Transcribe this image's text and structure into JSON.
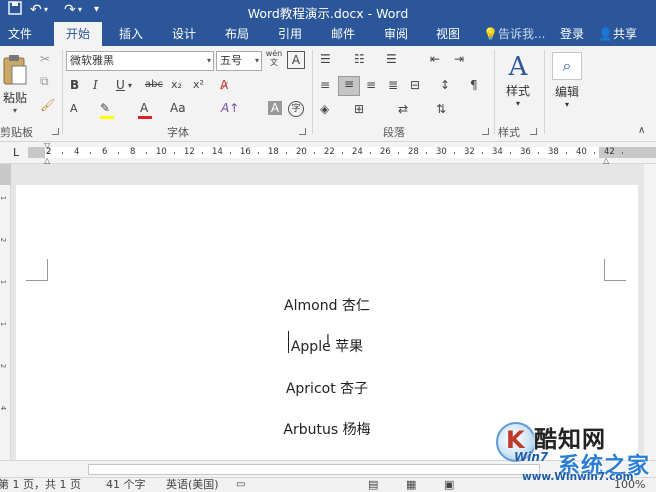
{
  "titlebar": {
    "title": "Word教程演示.docx - Word",
    "save_icon": "save-icon",
    "undo_icon": "undo-icon",
    "redo_icon": "redo-icon"
  },
  "menu": {
    "tabs": [
      {
        "label": "文件"
      },
      {
        "label": "开始",
        "active": true
      },
      {
        "label": "插入"
      },
      {
        "label": "设计"
      },
      {
        "label": "布局"
      },
      {
        "label": "引用"
      },
      {
        "label": "邮件"
      },
      {
        "label": "审阅"
      },
      {
        "label": "视图"
      }
    ],
    "tell_me": "告诉我...",
    "login": "登录",
    "share": "共享"
  },
  "ribbon": {
    "clipboard": {
      "paste": "粘贴",
      "label": "剪贴板"
    },
    "font": {
      "font_name": "微软雅黑",
      "font_size": "五号",
      "bold": "B",
      "italic": "I",
      "underline": "U",
      "strikethrough": "abc",
      "subscript": "x₂",
      "superscript": "x²",
      "font_color_letter": "A",
      "change_case": "Aa",
      "wen_top": "wén",
      "wen_bottom": "文",
      "char_border": "A",
      "char_shading": "A",
      "enclose": "字",
      "label": "字体"
    },
    "paragraph": {
      "label": "段落"
    },
    "styles": {
      "button": "样式",
      "label": "样式"
    },
    "editing": {
      "button": "编辑"
    }
  },
  "ruler": {
    "ticks": [
      "2",
      "2",
      "4",
      "6",
      "8",
      "10",
      "12",
      "14",
      "16",
      "18",
      "20",
      "22",
      "24",
      "26",
      "28",
      "30",
      "32",
      "34",
      "36",
      "38",
      "40",
      "42"
    ],
    "vticks": [
      "1",
      "2",
      "1",
      "1",
      "2",
      "4"
    ]
  },
  "document": {
    "lines": [
      {
        "en": "Almond",
        "zh": "杏仁"
      },
      {
        "en": "Apple",
        "zh": "苹果"
      },
      {
        "en": "Apricot",
        "zh": "杏子"
      },
      {
        "en": "Arbutus",
        "zh": "杨梅"
      }
    ]
  },
  "status": {
    "page": "第 1 页，共 1 页",
    "words": "41 个字",
    "language": "英语(美国)",
    "zoom": "100%"
  },
  "watermark": {
    "brand": "酷知网",
    "site_name": "系统之家",
    "win_text": "Win7",
    "url": "www.Winwin7.com"
  },
  "colors": {
    "accent": "#2b579a",
    "highlight": "#ffff00",
    "font_red": "#e02020"
  }
}
